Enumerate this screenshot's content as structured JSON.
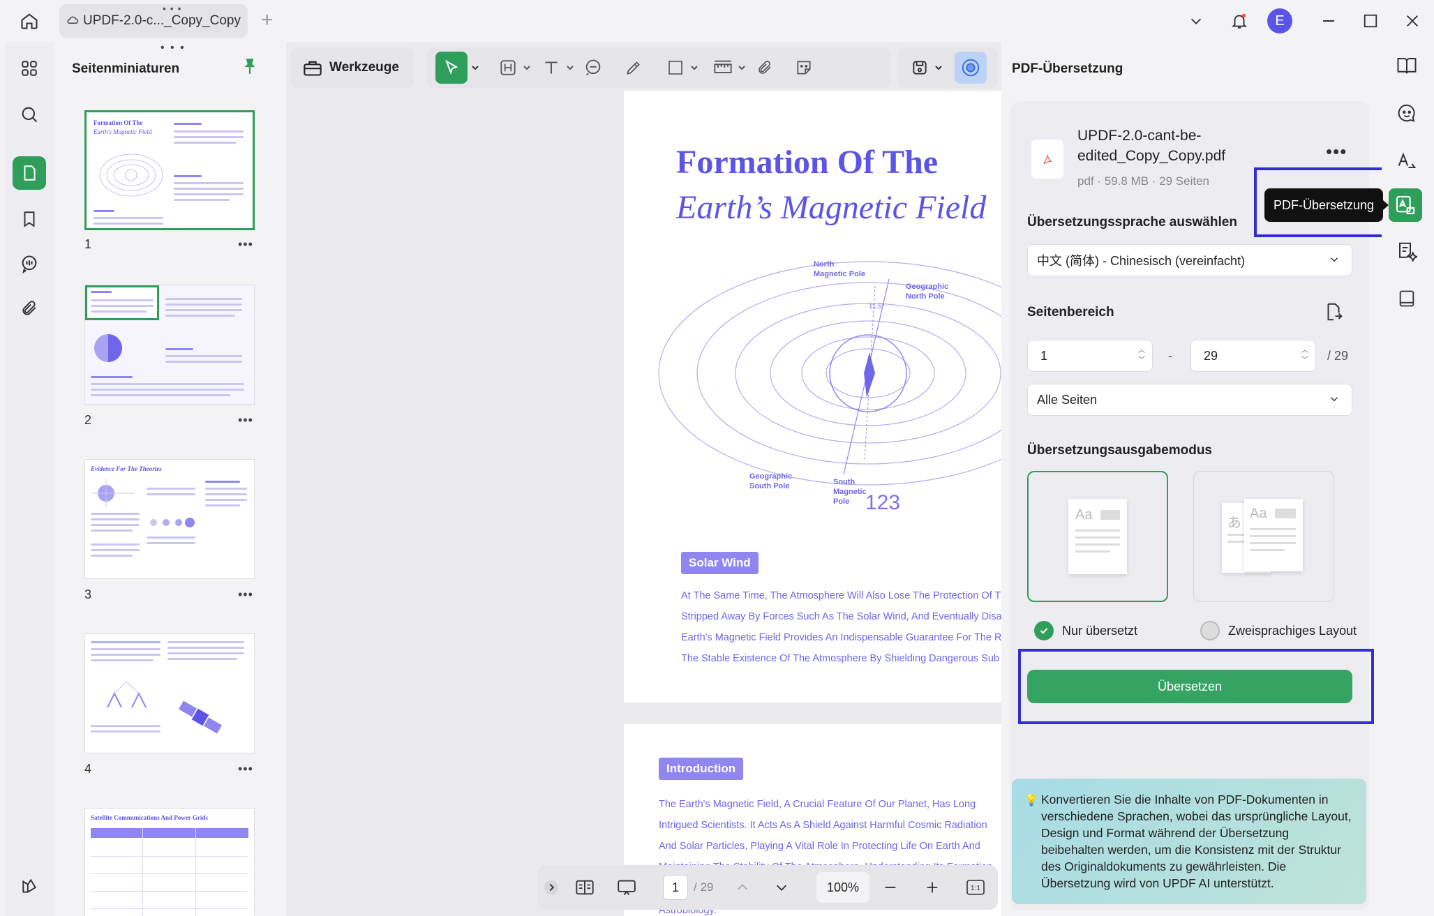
{
  "titlebar": {
    "tab_title": "UPDF-2.0-c..._Copy_Copy",
    "tab_dots": "• • •",
    "add_tab": "+",
    "avatar_letter": "E"
  },
  "left_rail": {
    "items": [
      "grid-icon",
      "search-icon",
      "page-icon",
      "bookmark-icon",
      "comment-icon",
      "attachment-icon",
      "layers-icon"
    ]
  },
  "thumbnails": {
    "title": "Seitenminiaturen",
    "pages": [
      {
        "number": "1",
        "more": "•••",
        "title": "Formation Of The",
        "subtitle": "Earth's Magnetic Field"
      },
      {
        "number": "2",
        "more": "•••"
      },
      {
        "number": "3",
        "more": "•••",
        "title": "Evidence For The Theories"
      },
      {
        "number": "4",
        "more": "•••"
      },
      {
        "number": "",
        "more": "",
        "title": "Satellite Communications And Power Grids"
      }
    ]
  },
  "toolbar": {
    "tools_label": "Werkzeuge"
  },
  "document": {
    "page1": {
      "title_line1": "Formation Of The",
      "title_line2": "Earth’s Magnetic Field",
      "figure_labels": {
        "north_magnetic": "North\nMagnetic Pole",
        "geographic_north": "Geographic\nNorth Pole",
        "geographic_south": "Geographic\nSouth Pole",
        "south_magnetic": "South\nMagnetic\nPole",
        "angle": "11.5°",
        "page_stamp": "123"
      },
      "section_tag": "Solar Wind",
      "paragraph": [
        "At The Same Time, The Atmosphere Will Also Lose The Protection Of T",
        "Stripped Away By Forces Such As The Solar Wind, And Eventually Disa",
        "Earth's Magnetic Field Provides An Indispensable Guarantee For The R",
        "The Stable Existence Of The Atmosphere By Shielding Dangerous Sub"
      ]
    },
    "page2": {
      "section_tag": "Introduction",
      "paragraph": [
        "The Earth's Magnetic Field, A Crucial Feature Of Our Planet, Has Long",
        "Intrigued Scientists. It Acts As A Shield Against Harmful Cosmic Radiation",
        "And Solar Particles, Playing A Vital Role In Protecting Life On Earth And",
        "Maintaining The Stability Of The Atmosphere. Understanding Its Formation",
        "Astrobiology."
      ]
    }
  },
  "bottom_bar": {
    "current_page": "1",
    "total_pages": "/ 29",
    "zoom": "100%"
  },
  "translate_panel": {
    "title": "PDF-Übersetzung",
    "file_name": "UPDF-2.0-cant-be-edited_Copy_Copy.pdf",
    "file_meta": "pdf · 59.8 MB · 29 Seiten",
    "file_more": "•••",
    "tooltip": "PDF-Übersetzung",
    "language_label": "Übersetzungssprache auswählen",
    "language_value": "中文 (简体) - Chinesisch (vereinfacht)",
    "range_label": "Seitenbereich",
    "range_from": "1",
    "range_sep": "-",
    "range_to": "29",
    "range_total": "/ 29",
    "range_mode": "Alle Seiten",
    "output_label": "Übersetzungsausgabemodus",
    "mode_only_translated": "Nur übersetzt",
    "mode_bilingual": "Zweisprachiges Layout",
    "mode_preview_aa": "Aa",
    "mode_preview_ja": "あ",
    "translate_button": "Übersetzen",
    "info_text": "Konvertieren Sie die Inhalte von PDF-Dokumenten in verschiedene Sprachen, wobei das ursprüngliche Layout, Design und Format während der Übersetzung beibehalten werden, um die Konsistenz mit der Struktur des Originaldokuments zu gewährleisten. Die Übersetzung wird von UPDF AI unterstützt."
  },
  "colors": {
    "accent_green": "#2e9e5a",
    "doc_purple": "#5b54e6",
    "highlight_blue": "#2f2fd0"
  }
}
